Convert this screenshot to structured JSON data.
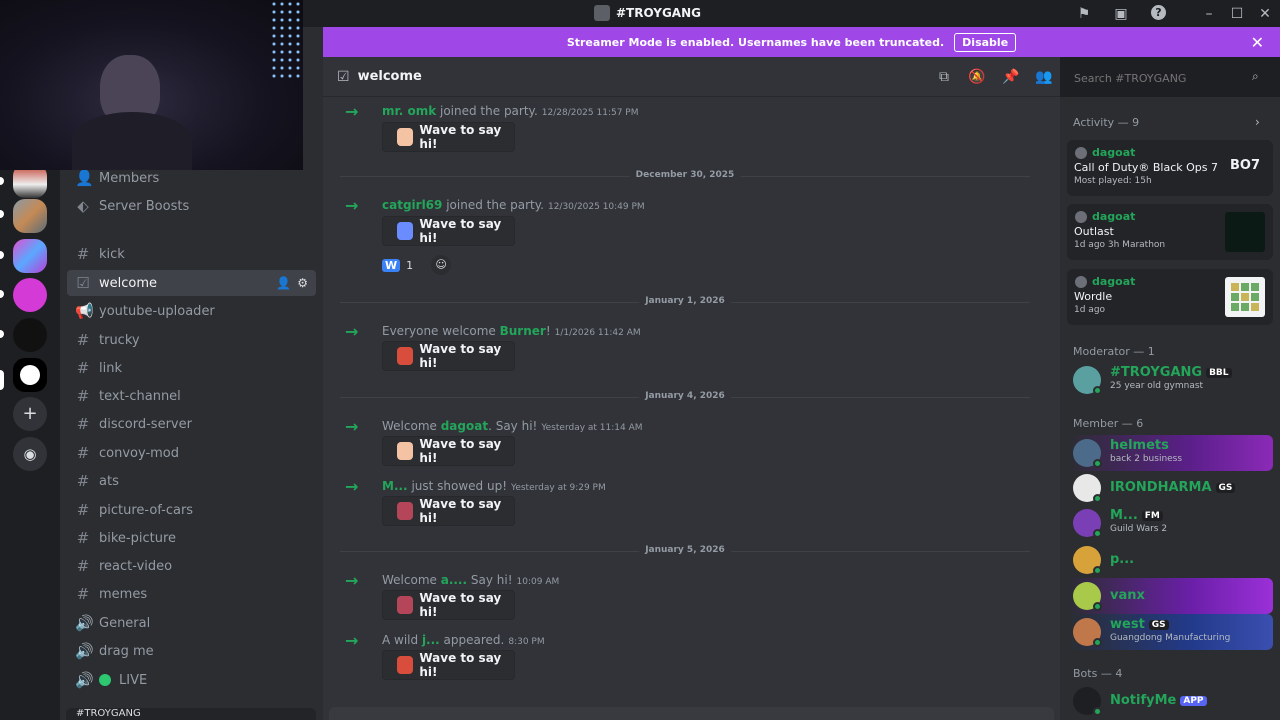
{
  "window": {
    "title": "#TROYGANG"
  },
  "banner": {
    "text": "Streamer Mode is enabled. Usernames have been truncated.",
    "disable_label": "Disable"
  },
  "channels": {
    "items": [
      {
        "label": "Members",
        "icon": "members-icon",
        "kind": "nav"
      },
      {
        "label": "Server Boosts",
        "icon": "boost-icon",
        "kind": "nav"
      },
      {
        "label": "kick",
        "icon": "hash-icon",
        "kind": "text"
      },
      {
        "label": "welcome",
        "icon": "rules-icon",
        "kind": "text",
        "active": true
      },
      {
        "label": "youtube-uploader",
        "icon": "announce-icon",
        "kind": "text"
      },
      {
        "label": "trucky",
        "icon": "hash-icon",
        "kind": "text"
      },
      {
        "label": "link",
        "icon": "hash-icon",
        "kind": "text"
      },
      {
        "label": "text-channel",
        "icon": "hash-icon",
        "kind": "text"
      },
      {
        "label": "discord-server",
        "icon": "hash-icon",
        "kind": "text"
      },
      {
        "label": "convoy-mod",
        "icon": "hash-icon",
        "kind": "text"
      },
      {
        "label": "ats",
        "icon": "hash-icon",
        "kind": "text"
      },
      {
        "label": "picture-of-cars",
        "icon": "hash-icon",
        "kind": "text"
      },
      {
        "label": "bike-picture",
        "icon": "hash-icon",
        "kind": "text"
      },
      {
        "label": "react-video",
        "icon": "hash-icon",
        "kind": "text"
      },
      {
        "label": "memes",
        "icon": "hash-icon",
        "kind": "text"
      },
      {
        "label": "General",
        "icon": "speaker-icon",
        "kind": "voice"
      },
      {
        "label": "drag me",
        "icon": "speaker-icon",
        "kind": "voice"
      },
      {
        "label": "LIVE",
        "icon": "speaker-icon",
        "kind": "voice"
      }
    ],
    "footer_server": "#TROYGANG"
  },
  "header": {
    "channel": "welcome",
    "search_placeholder": "Search #TROYGANG"
  },
  "messages": [
    {
      "pre": "",
      "name": "mr. omk",
      "post": " joined the party.",
      "time": "12/28/2025 11:57 PM",
      "wave": "Wave to say hi!"
    },
    {
      "date": "December 30, 2025"
    },
    {
      "pre": "",
      "name": "catgirl69",
      "post": " joined the party.",
      "time": "12/30/2025 10:49 PM",
      "wave": "Wave to say hi!",
      "reaction": {
        "emoji": "W",
        "count": "1"
      }
    },
    {
      "date": "January 1, 2026"
    },
    {
      "pre": "Everyone welcome ",
      "name": "Burner",
      "post": "!",
      "time": "1/1/2026 11:42 AM",
      "wave": "Wave to say hi!"
    },
    {
      "date": "January 4, 2026"
    },
    {
      "pre": "Welcome ",
      "name": "dagoat",
      "post": ". Say hi!",
      "time": "Yesterday at 11:14 AM",
      "wave": "Wave to say hi!"
    },
    {
      "pre": "",
      "name": "M...",
      "post": " just showed up!",
      "time": "Yesterday at 9:29 PM",
      "wave": "Wave to say hi!"
    },
    {
      "date": "January 5, 2026"
    },
    {
      "pre": "Welcome ",
      "name": "a....",
      "post": " Say hi!",
      "time": "10:09 AM",
      "wave": "Wave to say hi!"
    },
    {
      "pre": "A wild ",
      "name": "j...",
      "post": " appeared.",
      "time": "8:30 PM",
      "wave": "Wave to say hi!"
    }
  ],
  "activity": {
    "header": "Activity — 9",
    "cards": [
      {
        "user": "dagoat",
        "game": "Call of Duty® Black Ops 7",
        "meta": "Most played: 15h",
        "art": "BO7"
      },
      {
        "user": "dagoat",
        "game": "Outlast",
        "meta": "1d ago   3h Marathon",
        "art": ""
      },
      {
        "user": "dagoat",
        "game": "Wordle",
        "meta": "1d ago",
        "art": ""
      }
    ]
  },
  "moderator": {
    "header": "Moderator — 1",
    "members": [
      {
        "name": "#TROYGANG",
        "tag": "BBL",
        "sub": "25 year old gymnast"
      }
    ]
  },
  "member": {
    "header": "Member — 6",
    "members": [
      {
        "name": "helmets",
        "sub": "back 2 business",
        "tag": ""
      },
      {
        "name": "IRONDHARMA",
        "sub": "",
        "tag": "GS"
      },
      {
        "name": "M...",
        "sub": "Guild Wars 2",
        "tag": "FM"
      },
      {
        "name": "p...",
        "sub": "",
        "tag": ""
      },
      {
        "name": "vanx",
        "sub": "",
        "tag": ""
      },
      {
        "name": "west",
        "sub": "Guangdong Manufacturing",
        "tag": "GS"
      }
    ]
  },
  "bots": {
    "header": "Bots — 4",
    "members": [
      {
        "name": "NotifyMe",
        "tag": "APP"
      }
    ]
  },
  "colors": {
    "accent": "#23a55a",
    "banner": "#a047e8",
    "bg_main": "#313338",
    "bg_side": "#2b2d31"
  }
}
